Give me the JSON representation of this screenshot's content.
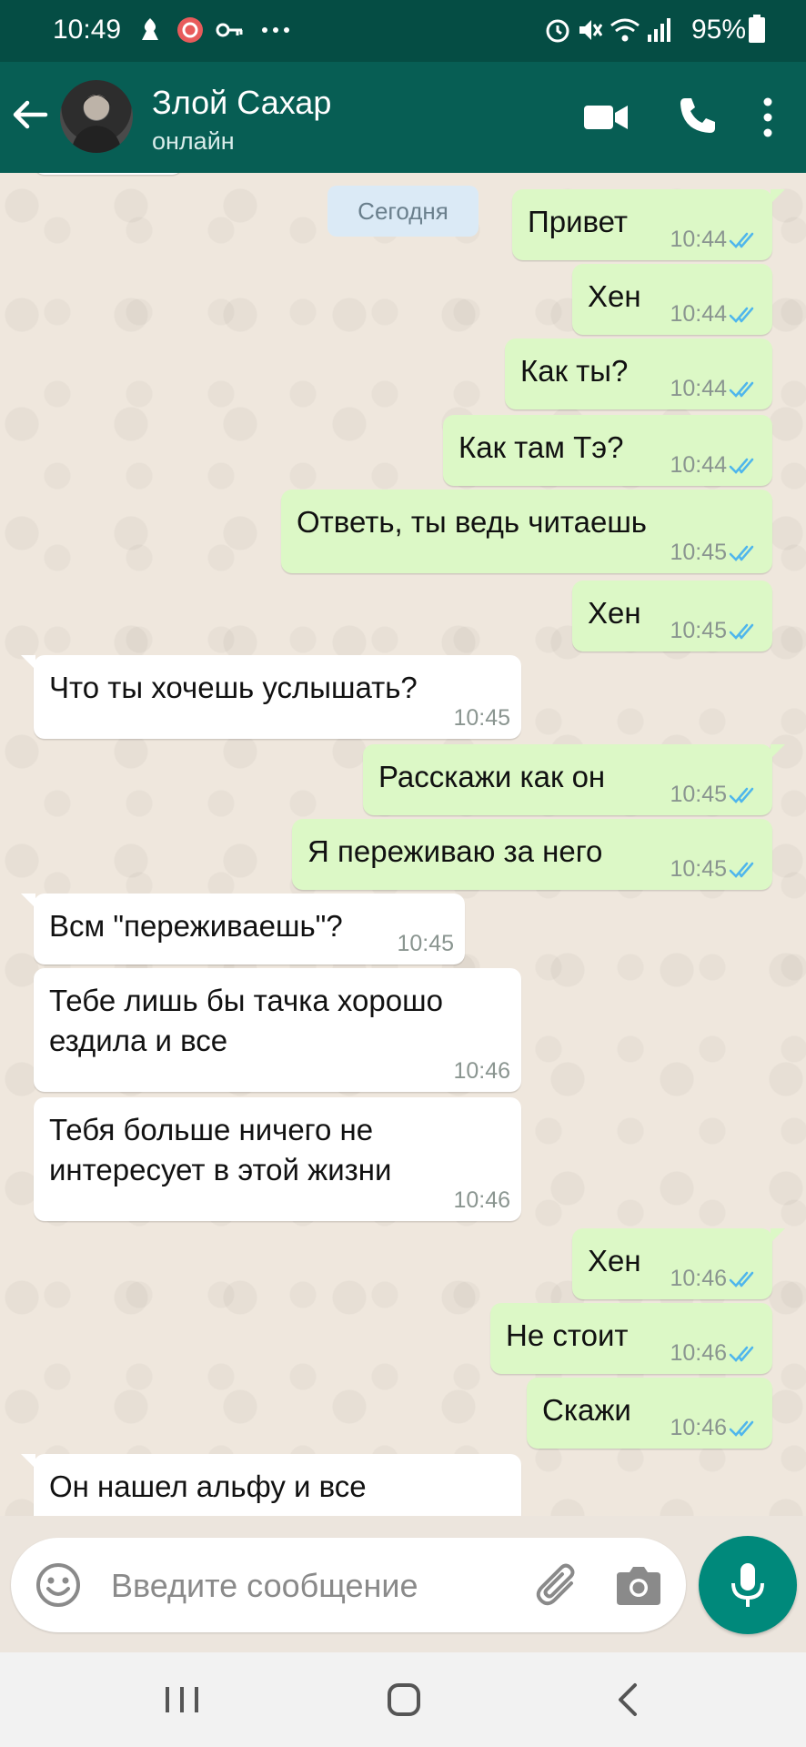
{
  "status_bar": {
    "time": "10:49",
    "battery": "95%"
  },
  "header": {
    "contact_name": "Злой Сахар",
    "contact_status": "онлайн"
  },
  "date_chip": "Сегодня",
  "messages": [
    {
      "dir": "out",
      "text": "Привет",
      "time": "10:44",
      "read": true
    },
    {
      "dir": "out",
      "text": "Хен",
      "time": "10:44",
      "read": true
    },
    {
      "dir": "out",
      "text": "Как ты?",
      "time": "10:44",
      "read": true
    },
    {
      "dir": "out",
      "text": "Как там Тэ?",
      "time": "10:44",
      "read": true
    },
    {
      "dir": "out",
      "text": "Ответь, ты ведь читаешь",
      "time": "10:45",
      "read": true
    },
    {
      "dir": "out",
      "text": "Хен",
      "time": "10:45",
      "read": true
    },
    {
      "dir": "in",
      "text": "Что ты хочешь услышать?",
      "time": "10:45"
    },
    {
      "dir": "out",
      "text": "Расскажи как он",
      "time": "10:45",
      "read": true
    },
    {
      "dir": "out",
      "text": "Я переживаю за него",
      "time": "10:45",
      "read": true
    },
    {
      "dir": "in",
      "text": "Всм \"переживаешь\"?",
      "time": "10:45"
    },
    {
      "dir": "in",
      "text": "Тебе лишь бы тачка хорошо\nездила и все",
      "time": "10:46"
    },
    {
      "dir": "in",
      "text": "Тебя больше ничего не\nинтересует в этой жизни",
      "time": "10:46"
    },
    {
      "dir": "out",
      "text": "Хен",
      "time": "10:46",
      "read": true
    },
    {
      "dir": "out",
      "text": "Не стоит",
      "time": "10:46",
      "read": true
    },
    {
      "dir": "out",
      "text": "Скажи",
      "time": "10:46",
      "read": true
    },
    {
      "dir": "in",
      "text": "Он нашел альфу и все",
      "time": ""
    }
  ],
  "input": {
    "placeholder": "Введите сообщение"
  },
  "colors": {
    "header": "#075e54",
    "status_bar": "#054d44",
    "outgoing_bubble": "#dcf8c6",
    "incoming_bubble": "#ffffff",
    "read_tick": "#4fb6ec",
    "fab": "#00897b"
  },
  "icons": {
    "back": "arrow-left-icon",
    "video": "video-call-icon",
    "call": "phone-icon",
    "menu": "more-vertical-icon",
    "emoji": "emoji-icon",
    "attach": "paperclip-icon",
    "camera": "camera-icon",
    "mic": "microphone-icon"
  }
}
